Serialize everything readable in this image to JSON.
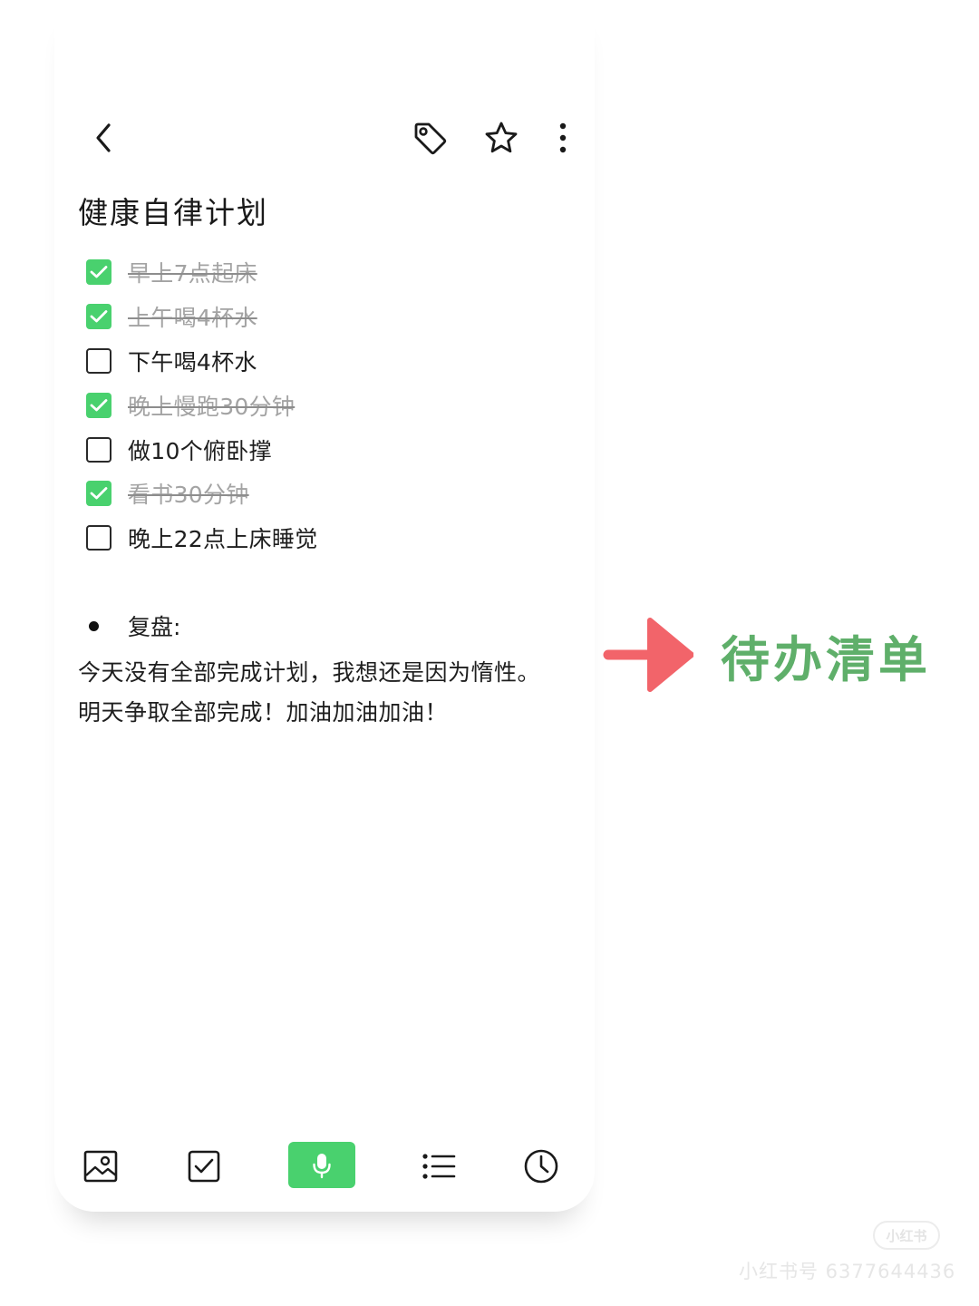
{
  "note": {
    "title": "健康自律计划",
    "checklist": [
      {
        "label": "早上7点起床",
        "checked": true
      },
      {
        "label": "上午喝4杯水",
        "checked": true
      },
      {
        "label": "下午喝4杯水",
        "checked": false
      },
      {
        "label": "晚上慢跑30分钟",
        "checked": true
      },
      {
        "label": "做10个俯卧撑",
        "checked": false
      },
      {
        "label": "看书30分钟",
        "checked": true
      },
      {
        "label": "晚上22点上床睡觉",
        "checked": false
      }
    ],
    "bullet": "复盘:",
    "body": "今天没有全部完成计划，我想还是因为惰性。明天争取全部完成！加油加油加油！"
  },
  "header": {
    "back_icon": "chevron-left-icon",
    "actions": [
      "tag-icon",
      "star-icon",
      "more-vertical-icon"
    ]
  },
  "toolbar": {
    "items": [
      "image-icon",
      "checkbox-icon",
      "microphone-icon",
      "list-icon",
      "clock-icon"
    ]
  },
  "annotation": {
    "label": "待办清单",
    "arrow_color": "#f2646a",
    "text_color": "#5faf6a"
  },
  "watermark": {
    "logo": "小红书",
    "text": "小红书号 6377644436"
  },
  "colors": {
    "accent": "#49d16e",
    "done_text": "#a3a3a3"
  }
}
